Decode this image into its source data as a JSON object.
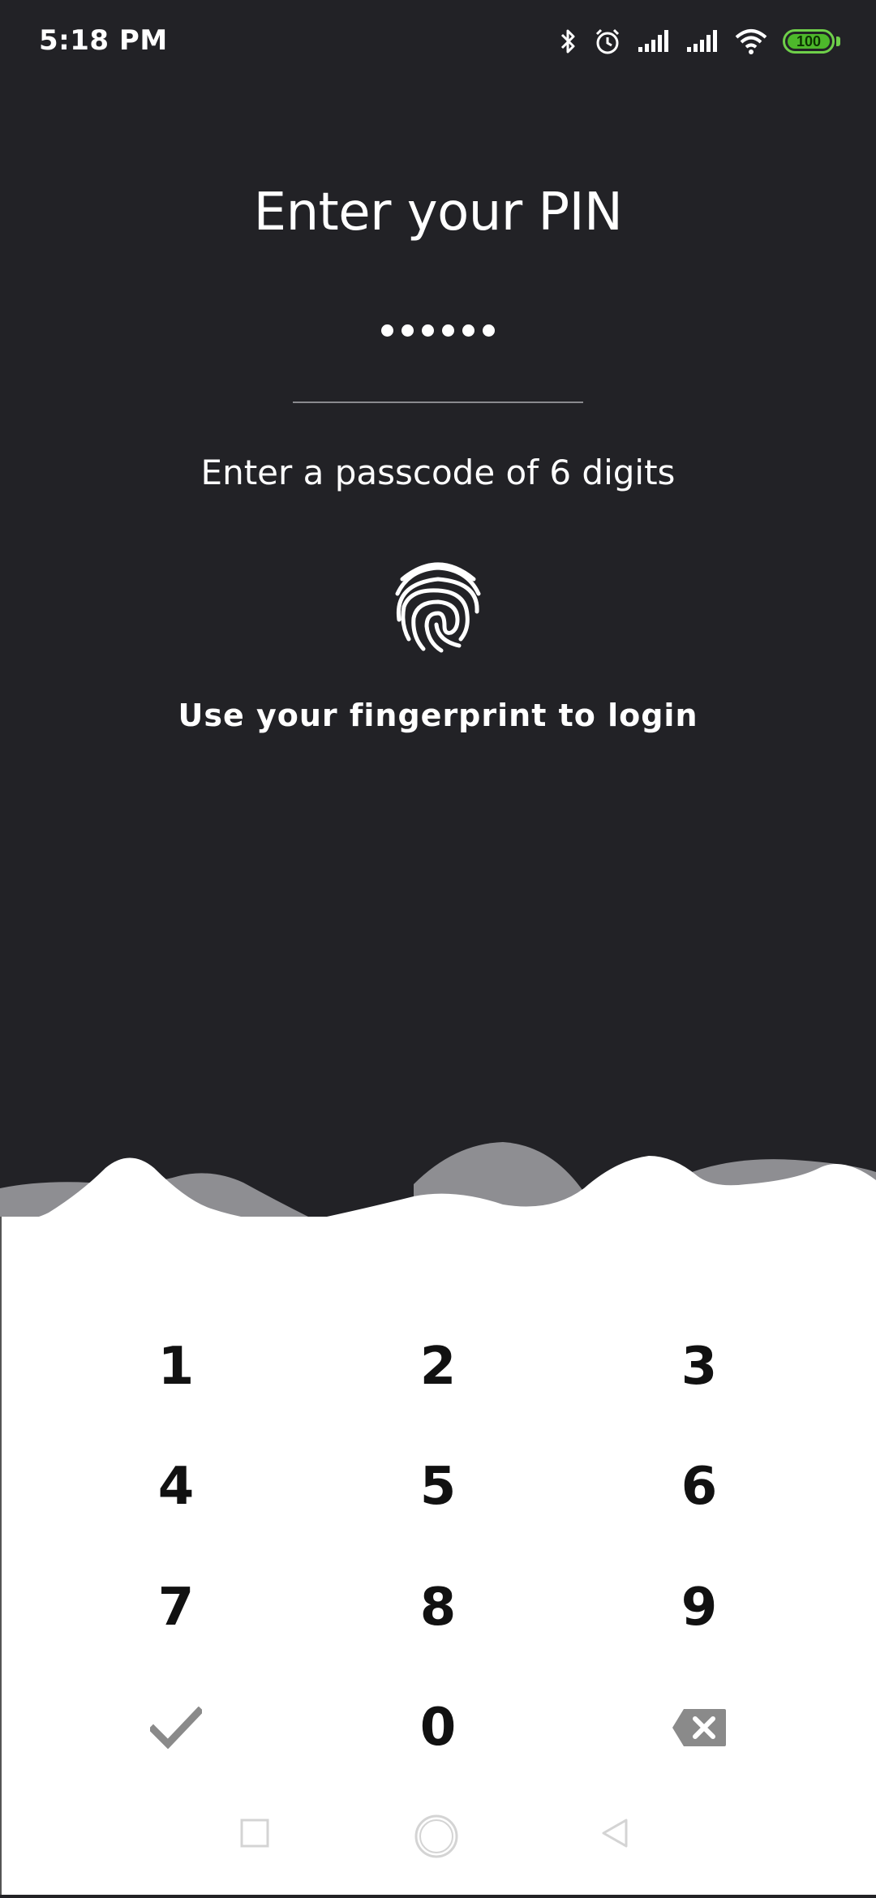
{
  "status_bar": {
    "time": "5:18 PM",
    "battery": "100",
    "icons": [
      "bluetooth-icon",
      "alarm-icon",
      "signal-icon",
      "signal-icon",
      "wifi-icon",
      "battery-icon"
    ],
    "battery_color": "#4db82b"
  },
  "header": {
    "title": "Enter your PIN"
  },
  "pin": {
    "entered_count": 6,
    "total_digits": 6
  },
  "hint": "Enter a passcode of 6 digits",
  "fingerprint": {
    "icon": "fingerprint-icon",
    "label": "Use your fingerprint to login"
  },
  "keypad": {
    "keys": [
      "1",
      "2",
      "3",
      "4",
      "5",
      "6",
      "7",
      "8",
      "9",
      "0"
    ],
    "confirm_icon": "checkmark-icon",
    "delete_icon": "backspace-icon"
  },
  "nav": {
    "icons": [
      "recent-apps-icon",
      "home-icon",
      "back-icon"
    ]
  },
  "colors": {
    "background": "#222226",
    "keypad": "#ffffff",
    "wave_gray": "#8e8e92",
    "accent_gray": "#8a8a8a"
  }
}
